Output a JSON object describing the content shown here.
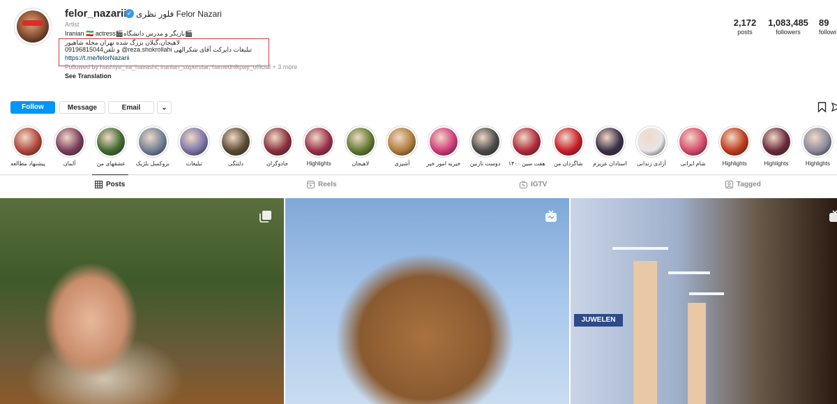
{
  "profile": {
    "username": "felor_nazarii",
    "full_name": "فلور نظری Felor Nazari",
    "category": "Artist",
    "bio_lines": [
      "Iranian 🇮🇷 actress🎬بازیگر و مدرس دانشگاه🎬",
      "لاهیجان،گیلان بزرگ شده تهران محله شاهپور",
      "و تلفن09196815044 @reza.shokrollahi تبلیغات دایرکت آقای شکرالهی"
    ],
    "link": "https://t.me/felorNazarii",
    "followed_by": "Followed by hashiye_va_havashi, iranian_superstar, hamednikpay_official + 3 more",
    "see_translation": "See Translation"
  },
  "stats": [
    {
      "value": "2,172",
      "label": "posts"
    },
    {
      "value": "1,083,485",
      "label": "followers"
    },
    {
      "value": "89",
      "label": "followi"
    }
  ],
  "actions": {
    "follow": "Follow",
    "message": "Message",
    "email": "Email",
    "dropdown_icon": "⌄"
  },
  "highlights": [
    {
      "label": "پیشنهاد مطالعه",
      "color": "#b0453a"
    },
    {
      "label": "آلمان",
      "color": "#7a3d5c"
    },
    {
      "label": "عشقهای من",
      "color": "#3f6b2d"
    },
    {
      "label": "بروکسل بلژیک",
      "color": "#6f7f96"
    },
    {
      "label": "تبلیغات",
      "color": "#7c74a8"
    },
    {
      "label": "دلتنگی",
      "color": "#5a4a32"
    },
    {
      "label": "جادوگران",
      "color": "#8a2f3a"
    },
    {
      "label": "Highlights",
      "color": "#9a2f4a"
    },
    {
      "label": "لاهیجان",
      "color": "#5f7a2e"
    },
    {
      "label": "آشپزی",
      "color": "#b07a3a"
    },
    {
      "label": "خیریه امور خیر",
      "color": "#d13a7a"
    },
    {
      "label": "دوست نازنین",
      "color": "#4a4a4a"
    },
    {
      "label": "هفت سین ۱۴۰۰",
      "color": "#b02a3a"
    },
    {
      "label": "شاگردان من",
      "color": "#c81c2a"
    },
    {
      "label": "استادان عزیزم",
      "color": "#3a3048"
    },
    {
      "label": "آزادی زندانی",
      "color": "#e6e6e6"
    },
    {
      "label": "شام ایرانی",
      "color": "#d84a6a"
    },
    {
      "label": "Highlights",
      "color": "#c0391b"
    },
    {
      "label": "Highlights",
      "color": "#6a2a3a"
    },
    {
      "label": "Highlights",
      "color": "#8a8a9a"
    }
  ],
  "tabs": [
    {
      "label": "Posts",
      "icon": "grid-icon"
    },
    {
      "label": "Reels",
      "icon": "reels-icon"
    },
    {
      "label": "IGTV",
      "icon": "igtv-icon"
    },
    {
      "label": "Tagged",
      "icon": "tagged-icon"
    }
  ],
  "posts": {
    "store_sign": "JUWELEN"
  }
}
